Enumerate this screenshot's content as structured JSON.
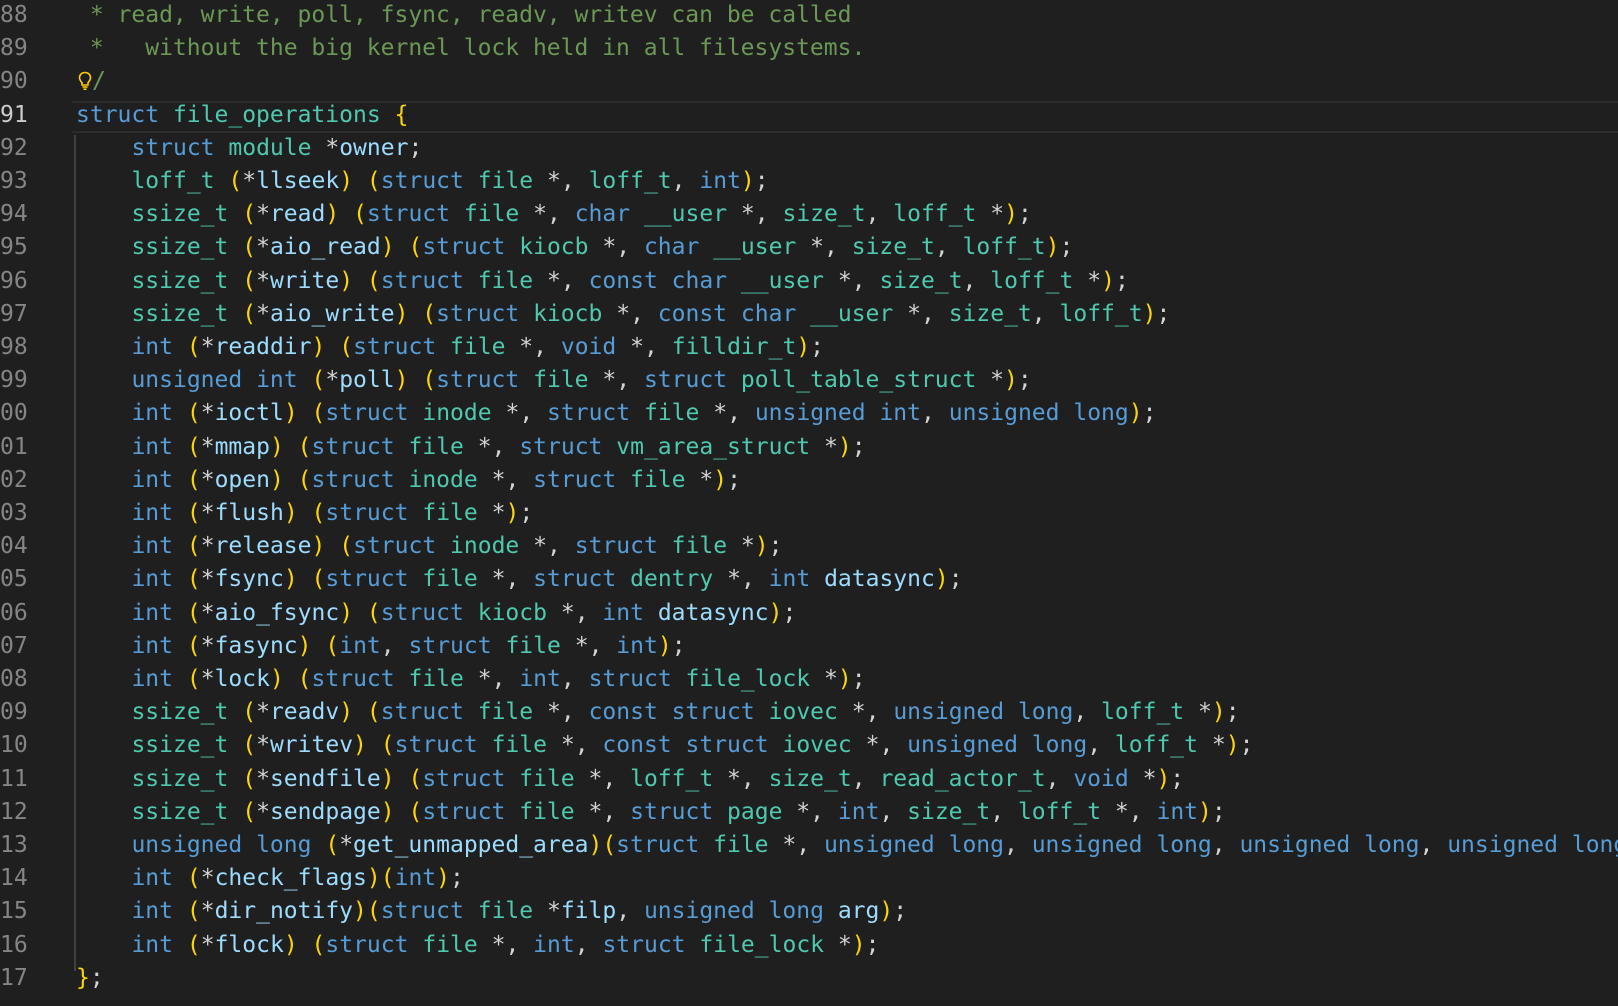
{
  "editor": {
    "lines": [
      {
        "num": "88",
        "text": " * read, write, poll, fsync, readv, writev can be called"
      },
      {
        "num": "89",
        "text": " *   without the big kernel lock held in all filesystems."
      },
      {
        "num": "90",
        "text": "/"
      },
      {
        "num": "91",
        "text": "struct file_operations {"
      },
      {
        "num": "92",
        "text": "    struct module *owner;"
      },
      {
        "num": "93",
        "text": "    loff_t (*llseek) (struct file *, loff_t, int);"
      },
      {
        "num": "94",
        "text": "    ssize_t (*read) (struct file *, char __user *, size_t, loff_t *);"
      },
      {
        "num": "95",
        "text": "    ssize_t (*aio_read) (struct kiocb *, char __user *, size_t, loff_t);"
      },
      {
        "num": "96",
        "text": "    ssize_t (*write) (struct file *, const char __user *, size_t, loff_t *);"
      },
      {
        "num": "97",
        "text": "    ssize_t (*aio_write) (struct kiocb *, const char __user *, size_t, loff_t);"
      },
      {
        "num": "98",
        "text": "    int (*readdir) (struct file *, void *, filldir_t);"
      },
      {
        "num": "99",
        "text": "    unsigned int (*poll) (struct file *, struct poll_table_struct *);"
      },
      {
        "num": "00",
        "text": "    int (*ioctl) (struct inode *, struct file *, unsigned int, unsigned long);"
      },
      {
        "num": "01",
        "text": "    int (*mmap) (struct file *, struct vm_area_struct *);"
      },
      {
        "num": "02",
        "text": "    int (*open) (struct inode *, struct file *);"
      },
      {
        "num": "03",
        "text": "    int (*flush) (struct file *);"
      },
      {
        "num": "04",
        "text": "    int (*release) (struct inode *, struct file *);"
      },
      {
        "num": "05",
        "text": "    int (*fsync) (struct file *, struct dentry *, int datasync);"
      },
      {
        "num": "06",
        "text": "    int (*aio_fsync) (struct kiocb *, int datasync);"
      },
      {
        "num": "07",
        "text": "    int (*fasync) (int, struct file *, int);"
      },
      {
        "num": "08",
        "text": "    int (*lock) (struct file *, int, struct file_lock *);"
      },
      {
        "num": "09",
        "text": "    ssize_t (*readv) (struct file *, const struct iovec *, unsigned long, loff_t *);"
      },
      {
        "num": "10",
        "text": "    ssize_t (*writev) (struct file *, const struct iovec *, unsigned long, loff_t *);"
      },
      {
        "num": "11",
        "text": "    ssize_t (*sendfile) (struct file *, loff_t *, size_t, read_actor_t, void *);"
      },
      {
        "num": "12",
        "text": "    ssize_t (*sendpage) (struct file *, struct page *, int, size_t, loff_t *, int);"
      },
      {
        "num": "13",
        "text": "    unsigned long (*get_unmapped_area)(struct file *, unsigned long, unsigned long, unsigned long, unsigned long"
      },
      {
        "num": "14",
        "text": "    int (*check_flags)(int);"
      },
      {
        "num": "15",
        "text": "    int (*dir_notify)(struct file *filp, unsigned long arg);"
      },
      {
        "num": "16",
        "text": "    int (*flock) (struct file *, int, struct file_lock *);"
      },
      {
        "num": "17",
        "text": "};"
      }
    ],
    "active_line": "91",
    "lightbulb_icon": "lightbulb-icon",
    "colors": {
      "background": "#1f1f1f",
      "comment": "#6a9955",
      "keyword": "#569cd6",
      "type": "#4ec9b0",
      "identifier": "#9cdcfe",
      "bracket_gold": "#ffd700",
      "bracket_purple": "#da70d6"
    }
  }
}
